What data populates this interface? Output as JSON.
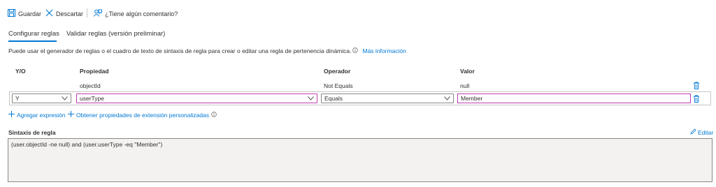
{
  "toolbar": {
    "save_label": "Guardar",
    "discard_label": "Descartar",
    "feedback_label": "¿Tiene algún comentario?"
  },
  "tabs": [
    {
      "label": "Configurar reglas",
      "active": true
    },
    {
      "label": "Validar reglas (versión preliminar)",
      "active": false
    }
  ],
  "description": {
    "text": "Puede usar el generador de reglas o el cuadro de texto de sintaxis de regla para crear o editar una regla de pertenencia dinámica.",
    "more_info_link": "Más información"
  },
  "table": {
    "headers": [
      "Y/O",
      "Propiedad",
      "Operador",
      "Valor"
    ],
    "rows": [
      {
        "andor": "",
        "property": "objectId",
        "operator": "Not Equals",
        "value": "null",
        "editable": false
      },
      {
        "andor": "Y",
        "property": "userType",
        "operator": "Equals",
        "value": "Member",
        "editable": true
      }
    ]
  },
  "actions": {
    "add_expression": "Agregar expresión",
    "get_extension_properties": "Obtener propiedades de extensión personalizadas"
  },
  "syntax": {
    "title": "Sintaxis de regla",
    "edit_label": "Editar",
    "text": "(user.objectId -ne null) and (user.userType -eq \"Member\")"
  },
  "colors": {
    "accent": "#0078d4",
    "focus_border": "#c239b3",
    "text": "#323130"
  }
}
